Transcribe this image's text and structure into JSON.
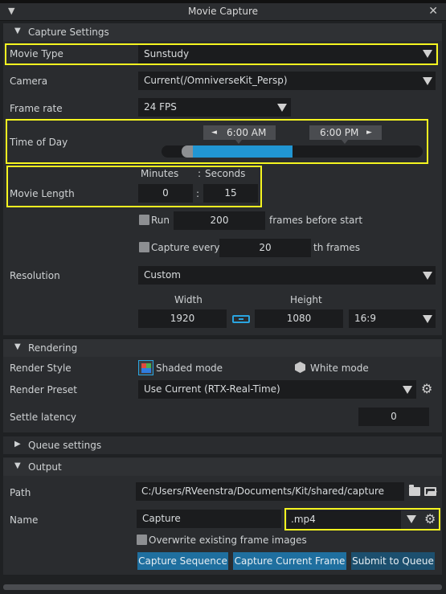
{
  "window": {
    "title": "Movie Capture"
  },
  "capture_settings": {
    "header": "Capture Settings",
    "movie_type": {
      "label": "Movie Type",
      "value": "Sunstudy"
    },
    "camera": {
      "label": "Camera",
      "value": "Current(/OmniverseKit_Persp)"
    },
    "frame_rate": {
      "label": "Frame rate",
      "value": "24 FPS"
    },
    "time_of_day": {
      "label": "Time of Day",
      "start": "6:00  AM",
      "end": "6:00  PM",
      "range": [
        0.1,
        0.5
      ]
    },
    "movie_length": {
      "label": "Movie Length",
      "minutes_label": "Minutes",
      "seconds_label": "Seconds",
      "colon": ":",
      "colon_top": ": ",
      "minutes": "0",
      "seconds": "15"
    },
    "run": {
      "label": "Run",
      "value": "200",
      "suffix": "frames before start"
    },
    "capture_every": {
      "label": "Capture every",
      "value": "20",
      "suffix": "th frames"
    },
    "resolution": {
      "label": "Resolution",
      "value": "Custom",
      "width_label": "Width",
      "height_label": "Height",
      "width": "1920",
      "height": "1080",
      "aspect": "16:9"
    }
  },
  "rendering": {
    "header": "Rendering",
    "render_style": {
      "label": "Render Style",
      "shaded": "Shaded mode",
      "white": "White mode"
    },
    "render_preset": {
      "label": "Render Preset",
      "value": "Use Current (RTX-Real-Time)"
    },
    "settle_latency": {
      "label": "Settle latency",
      "value": "0"
    }
  },
  "queue": {
    "header": "Queue settings"
  },
  "output": {
    "header": "Output",
    "path": {
      "label": "Path",
      "value": "C:/Users/RVeenstra/Documents/Kit/shared/capture"
    },
    "name": {
      "label": "Name",
      "value": "Capture",
      "ext": ".mp4"
    },
    "overwrite": {
      "label": "Overwrite existing frame images"
    },
    "buttons": {
      "capture_sequence": "Capture Sequence",
      "capture_current": "Capture Current Frame",
      "submit_queue": "Submit to Queue"
    }
  },
  "colors": {
    "accent": "#1f6f9f",
    "highlight": "#f5f520",
    "slider_fill": "#2196d3"
  }
}
